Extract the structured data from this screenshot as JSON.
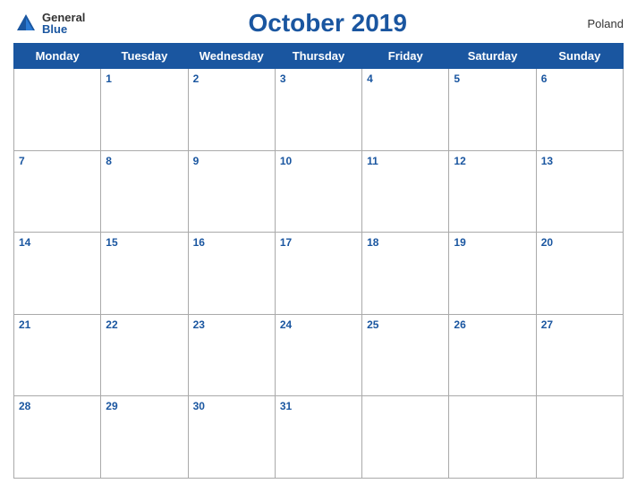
{
  "header": {
    "logo_general": "General",
    "logo_blue": "Blue",
    "title": "October 2019",
    "country": "Poland"
  },
  "weekdays": [
    "Monday",
    "Tuesday",
    "Wednesday",
    "Thursday",
    "Friday",
    "Saturday",
    "Sunday"
  ],
  "weeks": [
    [
      null,
      1,
      2,
      3,
      4,
      5,
      6
    ],
    [
      7,
      8,
      9,
      10,
      11,
      12,
      13
    ],
    [
      14,
      15,
      16,
      17,
      18,
      19,
      20
    ],
    [
      21,
      22,
      23,
      24,
      25,
      26,
      27
    ],
    [
      28,
      29,
      30,
      31,
      null,
      null,
      null
    ]
  ]
}
